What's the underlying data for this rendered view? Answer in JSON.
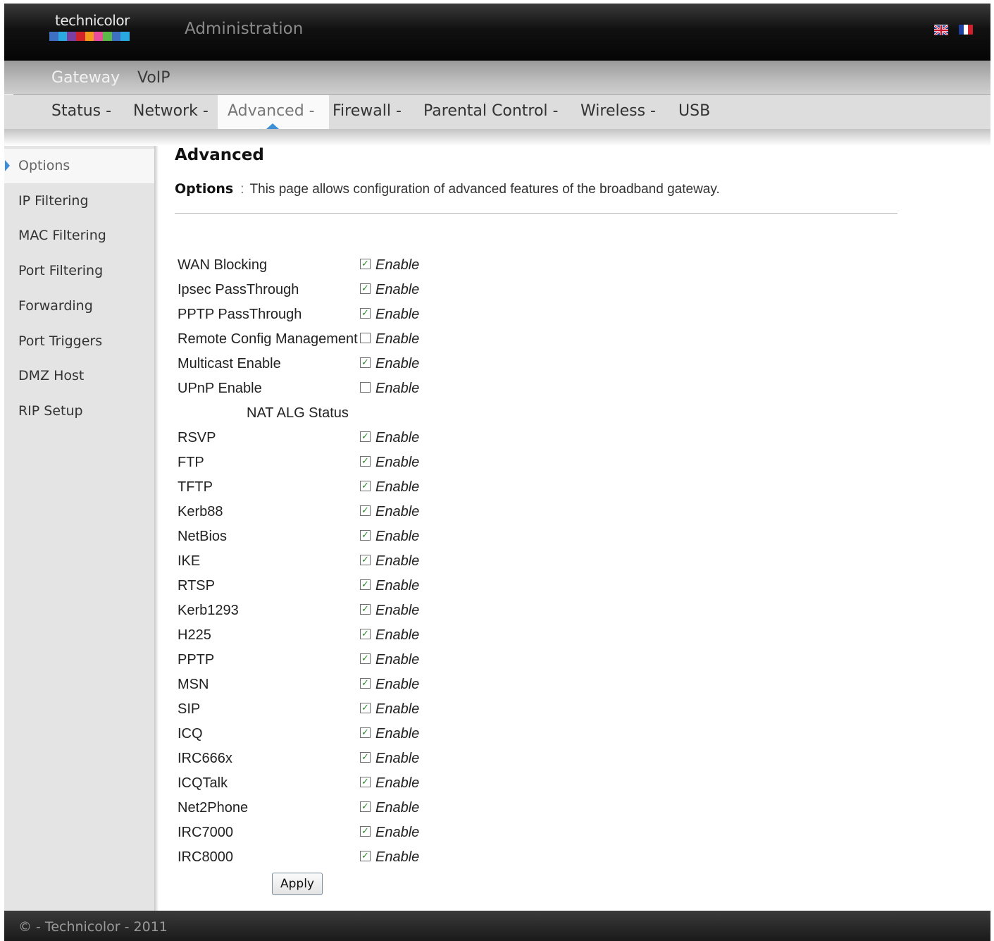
{
  "header": {
    "logo_text": "technicolor",
    "logo_colors": [
      "#3d6fc2",
      "#2aa9e0",
      "#7a3fa0",
      "#d2232a",
      "#f19a1b",
      "#e94e9c",
      "#5bb947",
      "#3d6fc2",
      "#2aa9e0"
    ],
    "title": "Administration",
    "languages": [
      "English",
      "Français"
    ]
  },
  "nav_primary": {
    "items": [
      "Gateway",
      "VoIP"
    ]
  },
  "nav_secondary": {
    "tabs": [
      {
        "label": "Status -"
      },
      {
        "label": "Network -"
      },
      {
        "label": "Advanced -",
        "active": true
      },
      {
        "label": "Firewall -"
      },
      {
        "label": "Parental Control -"
      },
      {
        "label": "Wireless -"
      },
      {
        "label": "USB"
      }
    ]
  },
  "sidebar": {
    "items": [
      {
        "label": "Options",
        "active": true
      },
      {
        "label": "IP Filtering"
      },
      {
        "label": "MAC Filtering"
      },
      {
        "label": "Port Filtering"
      },
      {
        "label": "Forwarding"
      },
      {
        "label": "Port Triggers"
      },
      {
        "label": "DMZ Host"
      },
      {
        "label": "RIP Setup"
      }
    ]
  },
  "main": {
    "title": "Advanced",
    "desc_label": "Options",
    "desc_colon": ":",
    "desc_text": "This page allows configuration of advanced features of the broadband gateway.",
    "enable_label": "Enable",
    "options": [
      {
        "label": "WAN Blocking",
        "checked": true
      },
      {
        "label": "Ipsec PassThrough",
        "checked": true
      },
      {
        "label": "PPTP PassThrough",
        "checked": true
      },
      {
        "label": "Remote Config Management",
        "checked": false
      },
      {
        "label": "Multicast Enable",
        "checked": true
      },
      {
        "label": "UPnP Enable",
        "checked": false
      }
    ],
    "nat_heading": "NAT ALG Status",
    "nat_options": [
      {
        "label": "RSVP",
        "checked": true
      },
      {
        "label": "FTP",
        "checked": true
      },
      {
        "label": "TFTP",
        "checked": true
      },
      {
        "label": "Kerb88",
        "checked": true
      },
      {
        "label": "NetBios",
        "checked": true
      },
      {
        "label": "IKE",
        "checked": true
      },
      {
        "label": "RTSP",
        "checked": true
      },
      {
        "label": "Kerb1293",
        "checked": true
      },
      {
        "label": "H225",
        "checked": true
      },
      {
        "label": "PPTP",
        "checked": true
      },
      {
        "label": "MSN",
        "checked": true
      },
      {
        "label": "SIP",
        "checked": true
      },
      {
        "label": "ICQ",
        "checked": true
      },
      {
        "label": "IRC666x",
        "checked": true
      },
      {
        "label": "ICQTalk",
        "checked": true
      },
      {
        "label": "Net2Phone",
        "checked": true
      },
      {
        "label": "IRC7000",
        "checked": true
      },
      {
        "label": "IRC8000",
        "checked": true
      }
    ],
    "apply_label": "Apply"
  },
  "footer": {
    "text": "© - Technicolor - 2011"
  }
}
